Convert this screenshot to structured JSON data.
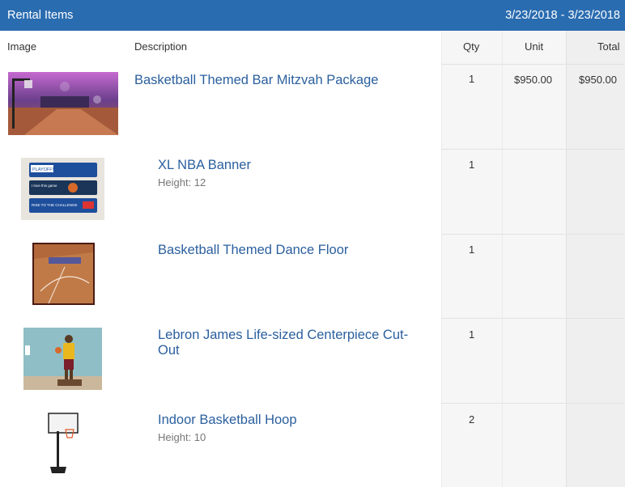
{
  "header": {
    "title": "Rental Items",
    "date_range": "3/23/2018 - 3/23/2018"
  },
  "columns": {
    "image": "Image",
    "description": "Description",
    "qty": "Qty",
    "unit": "Unit",
    "total": "Total"
  },
  "items": [
    {
      "title": "Basketball Themed Bar Mitzvah Package",
      "subtitle": "",
      "qty": "1",
      "unit": "$950.00",
      "total": "$950.00"
    },
    {
      "title": "XL NBA Banner",
      "subtitle": "Height: 12",
      "qty": "1",
      "unit": "",
      "total": ""
    },
    {
      "title": "Basketball Themed Dance Floor",
      "subtitle": "",
      "qty": "1",
      "unit": "",
      "total": ""
    },
    {
      "title": "Lebron James Life-sized Centerpiece Cut-Out",
      "subtitle": "",
      "qty": "1",
      "unit": "",
      "total": ""
    },
    {
      "title": "Indoor Basketball Hoop",
      "subtitle": "Height: 10",
      "qty": "2",
      "unit": "",
      "total": ""
    }
  ],
  "banner_thumb": {
    "text1": "PLAYOFFS",
    "text2": "I love this game",
    "text3": "RISE TO THE CHALLENGE"
  },
  "colors": {
    "header": "#2a6cb0",
    "link": "#2a5f9e"
  }
}
